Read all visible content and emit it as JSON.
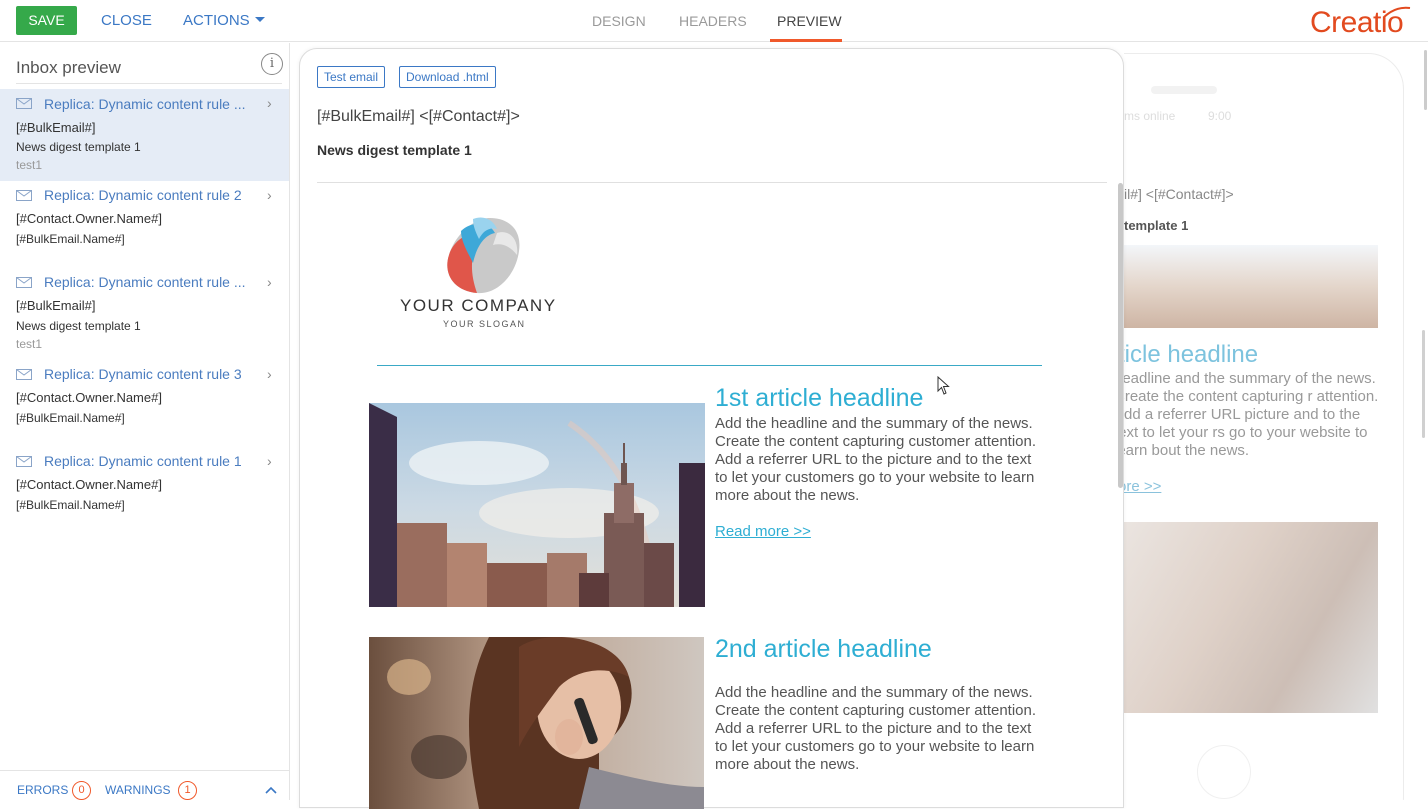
{
  "toolbar": {
    "save_label": "SAVE",
    "close_label": "CLOSE",
    "actions_label": "ACTIONS"
  },
  "tabs": [
    {
      "label": "DESIGN",
      "active": false
    },
    {
      "label": "HEADERS",
      "active": false
    },
    {
      "label": "PREVIEW",
      "active": true
    }
  ],
  "brand": {
    "logo_text": "Creatio",
    "color": "#e24a1f"
  },
  "inbox": {
    "title": "Inbox preview",
    "items": [
      {
        "subject": "Replica: Dynamic content rule ...",
        "from": "[#BulkEmail#]",
        "template": "News digest template 1",
        "preview": "test1",
        "selected": true
      },
      {
        "subject": "Replica: Dynamic content rule 2",
        "from": "[#Contact.Owner.Name#]",
        "template": "[#BulkEmail.Name#]",
        "preview": "",
        "selected": false
      },
      {
        "subject": "Replica: Dynamic content rule ...",
        "from": "[#BulkEmail#]",
        "template": "News digest template 1",
        "preview": "test1",
        "selected": false
      },
      {
        "subject": "Replica: Dynamic content rule 3",
        "from": "[#Contact.Owner.Name#]",
        "template": "[#BulkEmail.Name#]",
        "preview": "",
        "selected": false
      },
      {
        "subject": "Replica: Dynamic content rule 1",
        "from": "[#Contact.Owner.Name#]",
        "template": "[#BulkEmail.Name#]",
        "preview": "",
        "selected": false
      }
    ],
    "footer": {
      "errors_label": "ERRORS",
      "errors_count": "0",
      "warnings_label": "WARNINGS",
      "warnings_count": "1"
    }
  },
  "preview": {
    "test_email_label": "Test email",
    "download_label": "Download .html",
    "header_line": "[#BulkEmail#] <[#Contact#]>",
    "subject": "News digest template 1",
    "company_name": "YOUR COMPANY",
    "company_slogan": "YOUR SLOGAN",
    "articles": [
      {
        "headline": "1st article headline",
        "body": "Add the headline and the summary of the news. Create the content capturing customer attention. Add a referrer URL to the picture and to the text to let your customers go to your website to learn more about the news.",
        "link": "Read more >>"
      },
      {
        "headline": "2nd article headline",
        "body": "Add the headline and the summary of the news. Create the content capturing customer attention. Add a referrer URL to the picture and to the text to let your customers go to your website to learn more about the news."
      }
    ]
  },
  "mobile_preview": {
    "status_text": "ms online",
    "status_time": "9:00",
    "header_line": "il#] <[#Contact#]>",
    "subject": "template 1",
    "headline": "rticle headline",
    "body": "headline and the summary of the news. Create the content capturing r attention. Add a referrer URL picture and to the text to let your rs go to your website to learn bout the news.",
    "link": "ore >>"
  },
  "colors": {
    "accent": "#3b78c5",
    "save": "#35a94a",
    "tab_active": "#f0592b",
    "headline": "#2eaed3"
  }
}
